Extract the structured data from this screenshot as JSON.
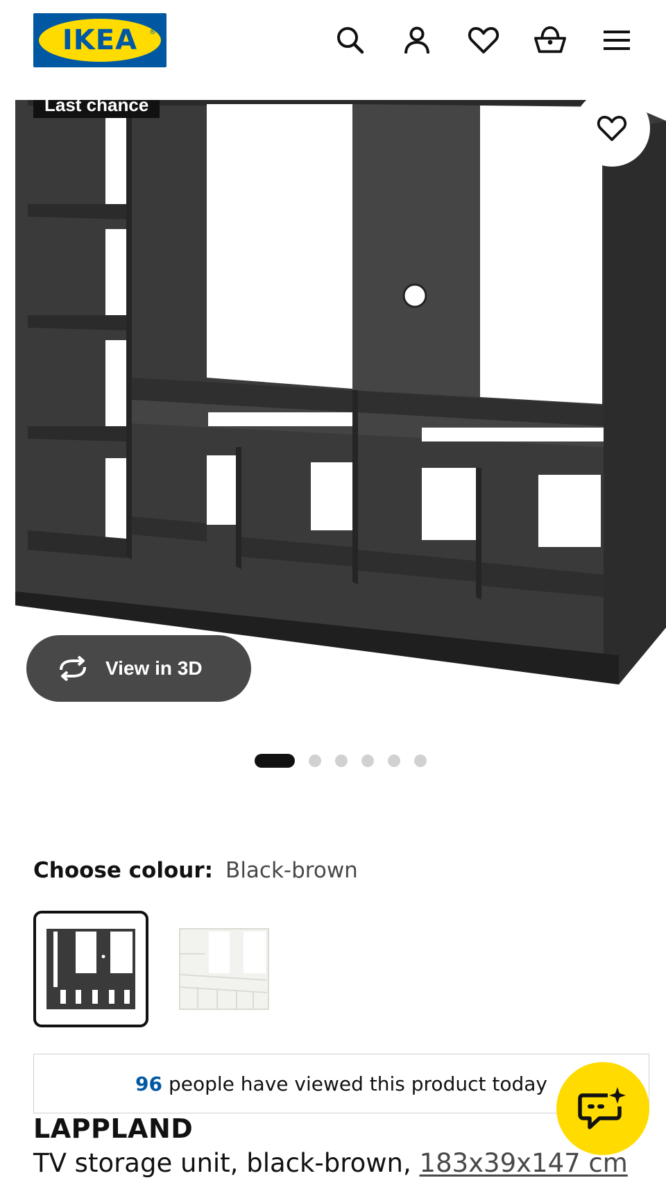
{
  "header": {
    "logo_text": "IKEA",
    "icons": [
      "search-icon",
      "account-icon",
      "heart-icon",
      "basket-icon",
      "menu-icon"
    ]
  },
  "hero": {
    "badge": "Last chance",
    "view_3d_label": "View in 3D",
    "carousel": {
      "total": 6,
      "active_index": 0
    }
  },
  "colour": {
    "label": "Choose colour:",
    "selected": "Black-brown",
    "options": [
      "black-brown",
      "white"
    ]
  },
  "viewed": {
    "count": "96",
    "text": "people have viewed this product today"
  },
  "product": {
    "name": "LAPPLAND",
    "description": "TV storage unit, black-brown, ",
    "dimensions": "183x39x147 cm"
  },
  "colors": {
    "ikea_blue": "#0058a3",
    "ikea_yellow": "#ffdb00",
    "furniture": "#3b3b3b"
  }
}
